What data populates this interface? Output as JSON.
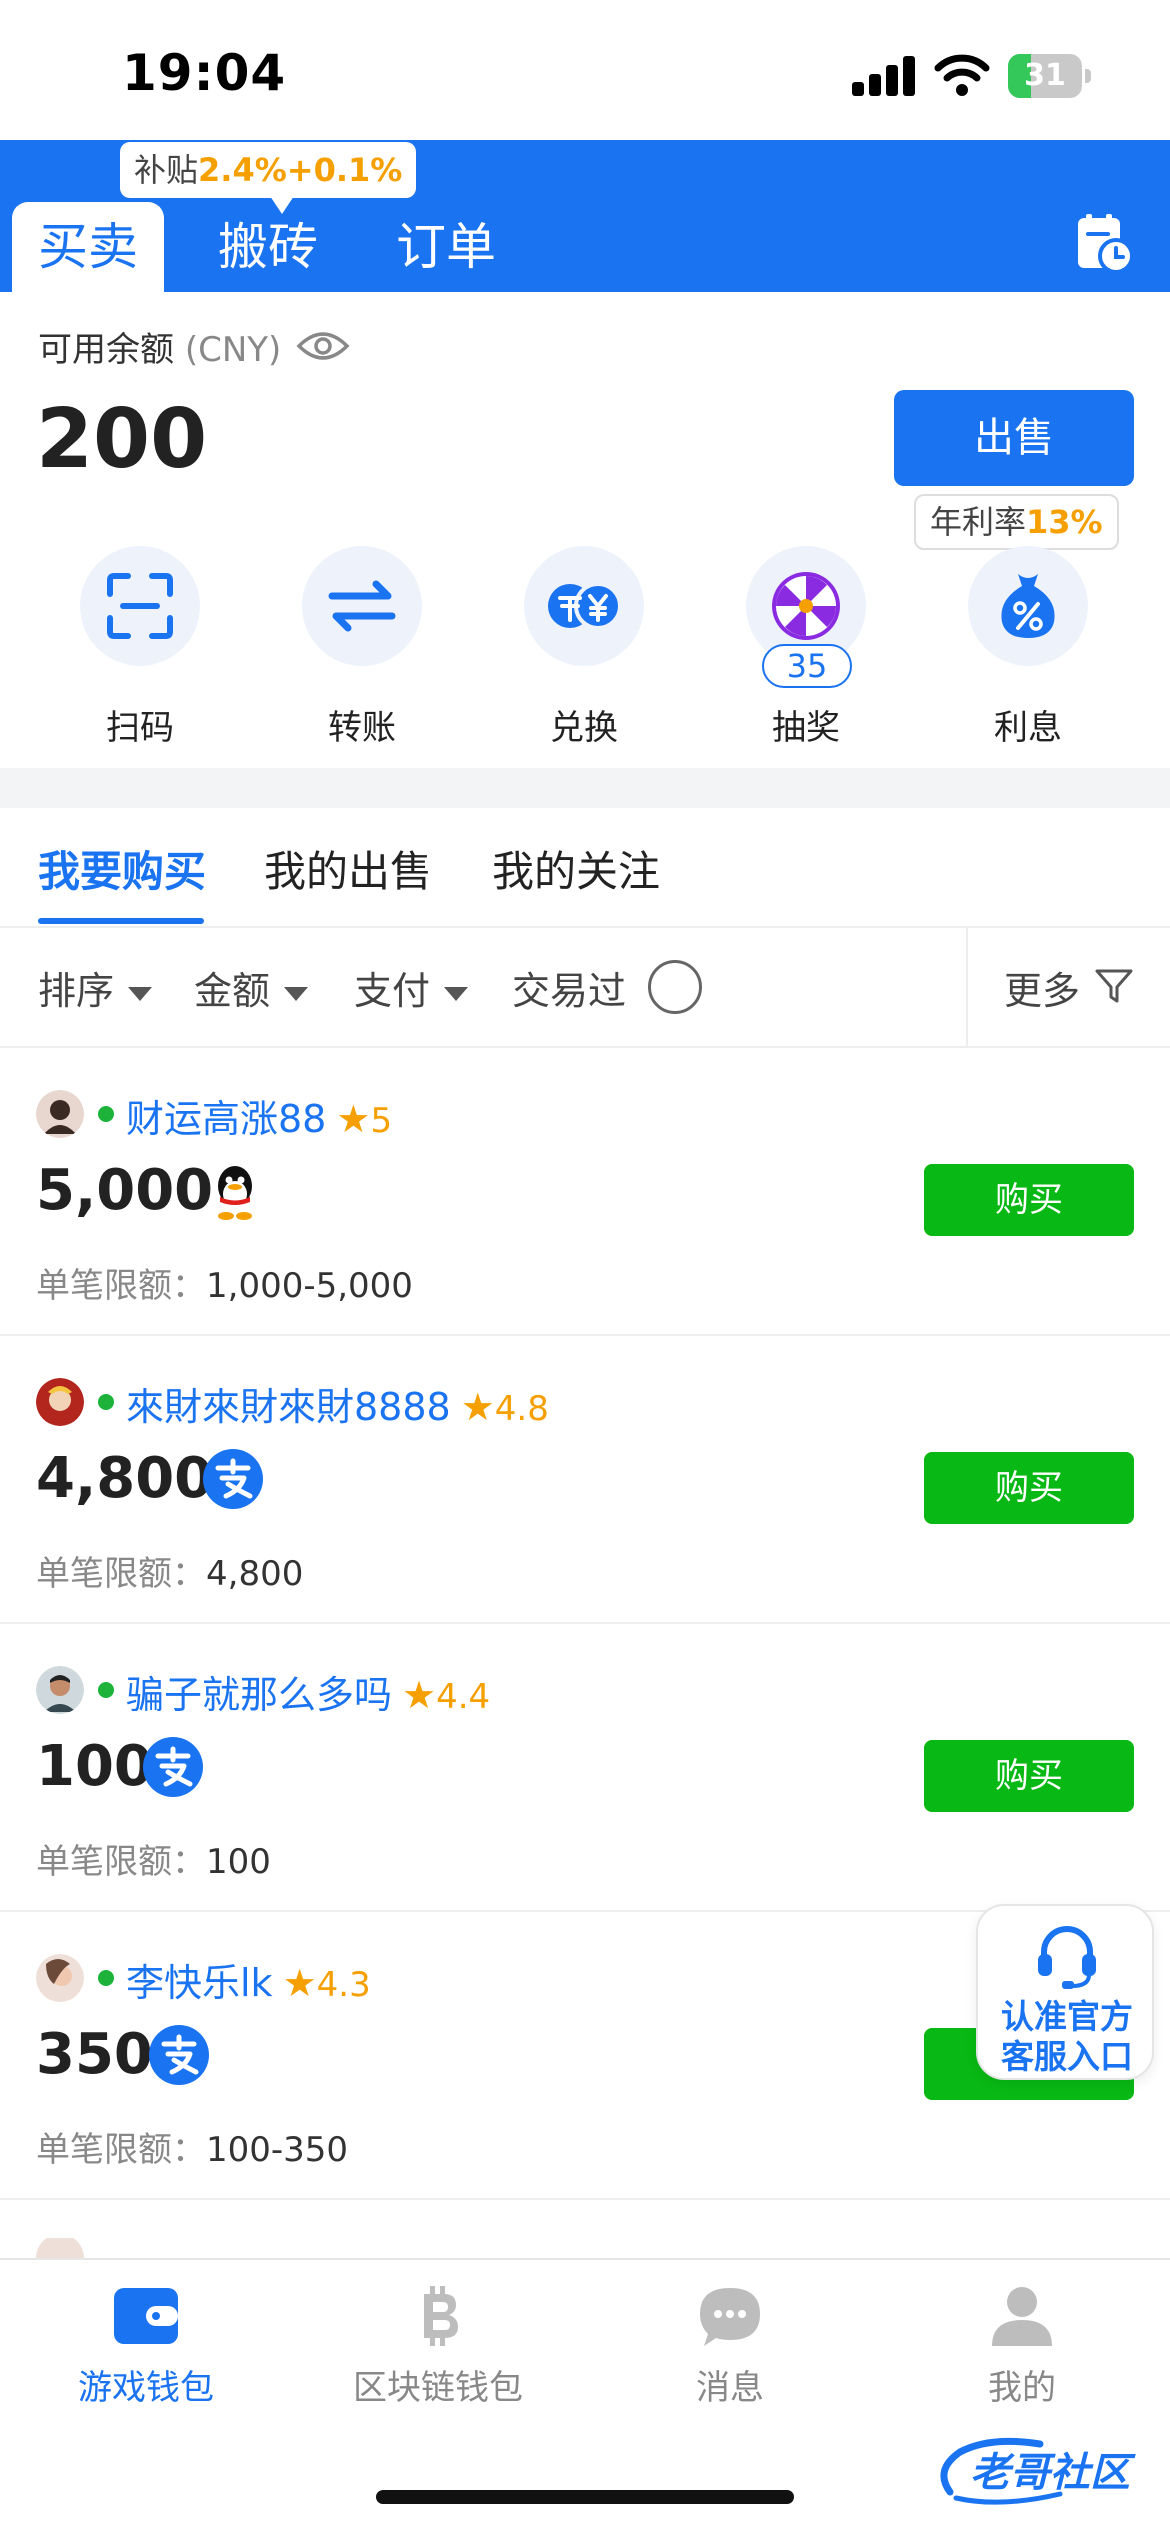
{
  "status_bar": {
    "time": "19:04",
    "battery_level": "31",
    "battery_fraction": 0.31
  },
  "colors": {
    "brand": "#1a73f0",
    "buy": "#08b814",
    "highlight": "#f5a000",
    "online": "#1db33a"
  },
  "header": {
    "subsidy_prefix": "补贴",
    "subsidy_rate": "2.4%+0.1%",
    "tabs": [
      "买卖",
      "搬砖",
      "订单"
    ],
    "active_tab": 0,
    "history_icon": "order-history-icon"
  },
  "balance": {
    "label": "可用余额",
    "currency": "(CNY)",
    "amount": "200",
    "sell_label": "出售",
    "apr_prefix": "年利率",
    "apr_rate": "13%"
  },
  "actions": [
    {
      "label": "扫码",
      "icon": "scan-icon"
    },
    {
      "label": "转账",
      "icon": "transfer-icon"
    },
    {
      "label": "兑换",
      "icon": "exchange-icon"
    },
    {
      "label": "抽奖",
      "icon": "lottery-wheel-icon",
      "badge": "35"
    },
    {
      "label": "利息",
      "icon": "interest-bag-icon"
    }
  ],
  "segment_tabs": [
    "我要购买",
    "我的出售",
    "我的关注"
  ],
  "filters": {
    "sort": "排序",
    "amount": "金额",
    "payment": "支付",
    "traded": "交易过",
    "more": "更多"
  },
  "listings": [
    {
      "name": "财运高涨88",
      "rating": "5",
      "amount": "5,000",
      "payment": "qq",
      "limit_label": "单笔限额：",
      "limit": "1,000-5,000",
      "buy_label": "购买"
    },
    {
      "name": "來財來財來財8888",
      "rating": "4.8",
      "amount": "4,800",
      "payment": "alipay",
      "limit_label": "单笔限额：",
      "limit": "4,800",
      "buy_label": "购买"
    },
    {
      "name": "骗子就那么多吗",
      "rating": "4.4",
      "amount": "100",
      "payment": "alipay",
      "limit_label": "单笔限额：",
      "limit": "100",
      "buy_label": "购买"
    },
    {
      "name": "李快乐lk",
      "rating": "4.3",
      "amount": "350",
      "payment": "alipay",
      "limit_label": "单笔限额：",
      "limit": "100-350",
      "buy_label": "购买"
    }
  ],
  "customer_service": {
    "line1": "认准官方",
    "line2": "客服入口"
  },
  "tabbar": [
    {
      "label": "游戏钱包",
      "icon": "wallet-icon",
      "active": true
    },
    {
      "label": "区块链钱包",
      "icon": "bitcoin-icon",
      "active": false
    },
    {
      "label": "消息",
      "icon": "message-icon",
      "active": false
    },
    {
      "label": "我的",
      "icon": "profile-icon",
      "active": false
    }
  ],
  "watermark": "老哥社区"
}
